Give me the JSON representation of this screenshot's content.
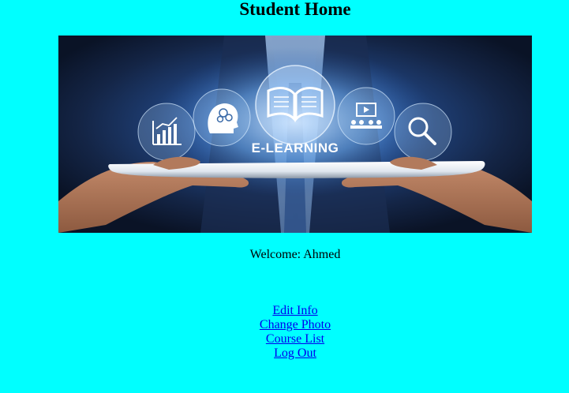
{
  "page": {
    "title": "Student Home"
  },
  "banner": {
    "text": "E-LEARNING",
    "icons": [
      "chart-icon",
      "brain-icon",
      "book-icon",
      "presentation-icon",
      "magnifier-icon"
    ]
  },
  "welcome": {
    "label": "Welcome: Ahmed"
  },
  "links": [
    {
      "label": "Edit Info"
    },
    {
      "label": "Change Photo"
    },
    {
      "label": "Course List"
    },
    {
      "label": "Log Out"
    }
  ],
  "colors": {
    "background": "#00ffff",
    "link": "#0000ee"
  }
}
